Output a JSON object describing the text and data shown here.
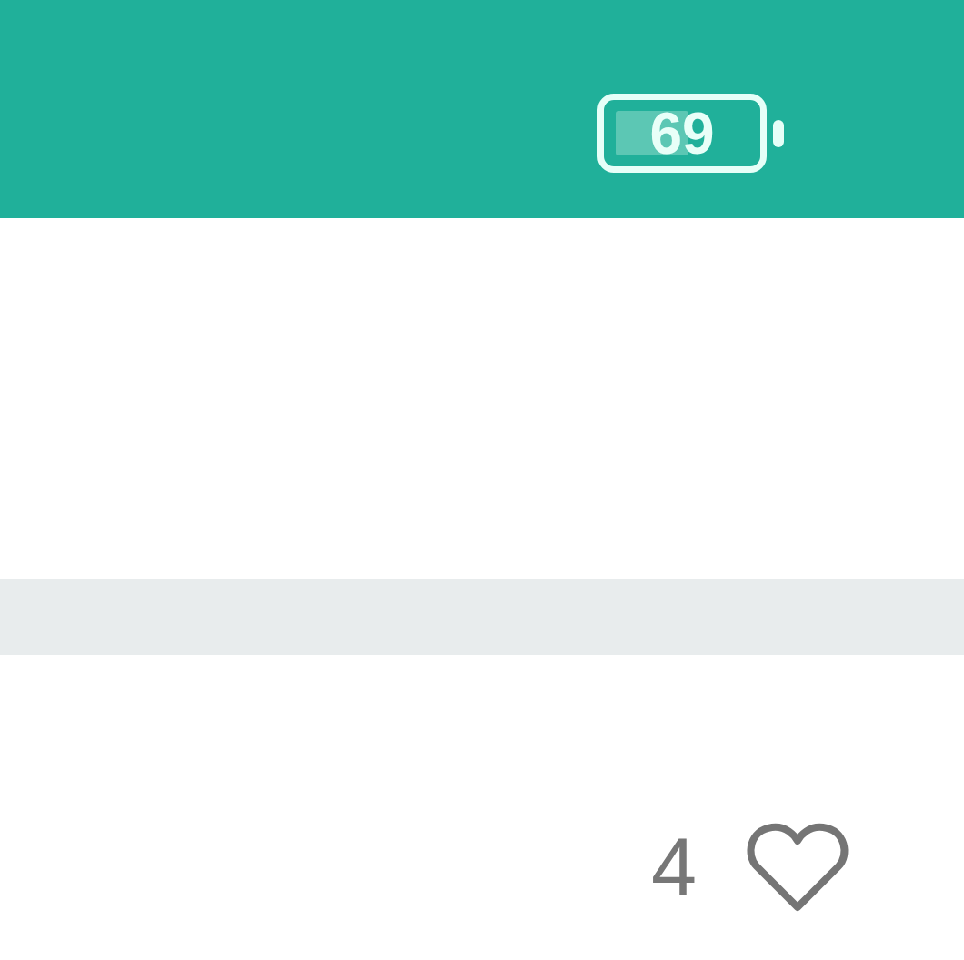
{
  "status_bar": {
    "battery": "69"
  },
  "post": {
    "like_count": "4",
    "liked": false
  }
}
